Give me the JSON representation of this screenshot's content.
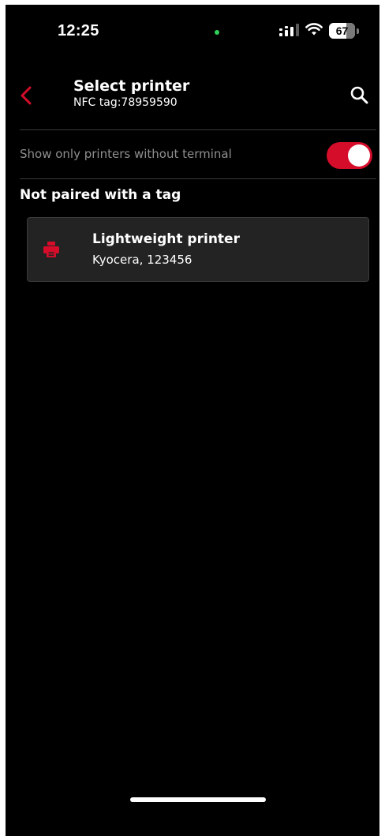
{
  "status_bar": {
    "time": "12:25",
    "battery_percent": "67",
    "battery_level": 0.67,
    "icons": [
      "signal-icon",
      "wifi-icon",
      "battery-icon"
    ],
    "indicator_color": "#30d158"
  },
  "header": {
    "title": "Select printer",
    "subtitle": "NFC tag:78959590",
    "back_icon": "chevron-left-icon",
    "search_icon": "search-icon"
  },
  "filter": {
    "label": "Show only printers without terminal",
    "enabled": true
  },
  "section": {
    "heading": "Not paired with a tag"
  },
  "printers": [
    {
      "name": "Lightweight printer",
      "details": "Kyocera, 123456",
      "icon": "printer-icon"
    }
  ],
  "colors": {
    "accent": "#d50d2b",
    "background": "#000000",
    "card": "#232323"
  }
}
